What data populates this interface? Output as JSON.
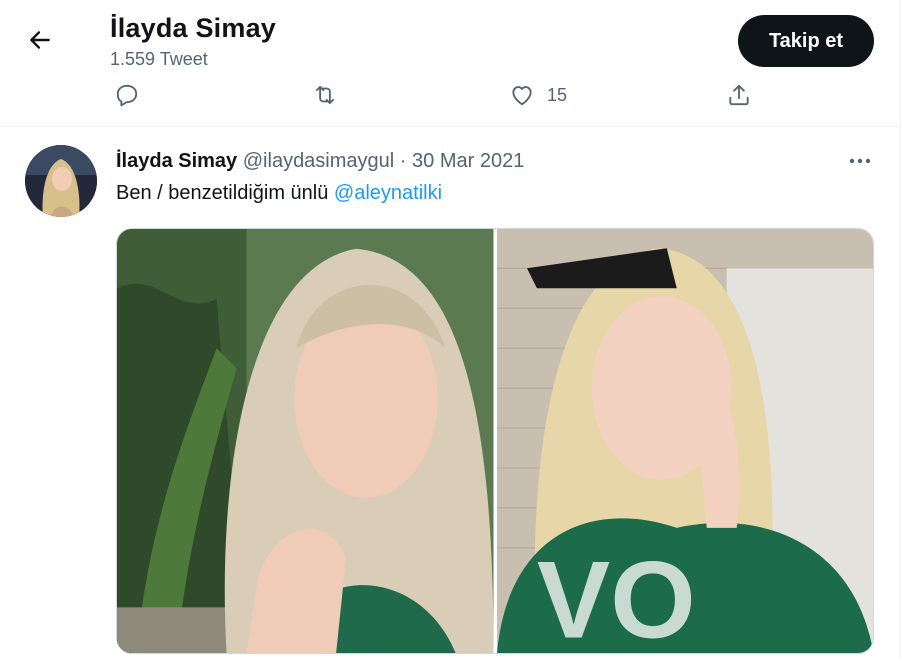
{
  "header": {
    "title": "İlayda Simay",
    "tweet_count": "1.559 Tweet",
    "follow_label": "Takip et",
    "back_icon": "arrow-left-icon"
  },
  "actions": {
    "reply_icon": "reply-icon",
    "retweet_icon": "retweet-icon",
    "like_icon": "heart-icon",
    "like_count": "15",
    "share_icon": "share-icon"
  },
  "tweet": {
    "author_name": "İlayda Simay",
    "author_handle": "@ilaydasimaygul",
    "separator": "·",
    "date": "30 Mar 2021",
    "text": "Ben / benzetildiğim ünlü",
    "mention": "@aleynatilki",
    "more_icon": "more-horizontal-icon"
  },
  "colors": {
    "primary_text": "#0f1419",
    "secondary_text": "#536471",
    "link": "#1d9bf0",
    "follow_button": "#0f1419"
  }
}
